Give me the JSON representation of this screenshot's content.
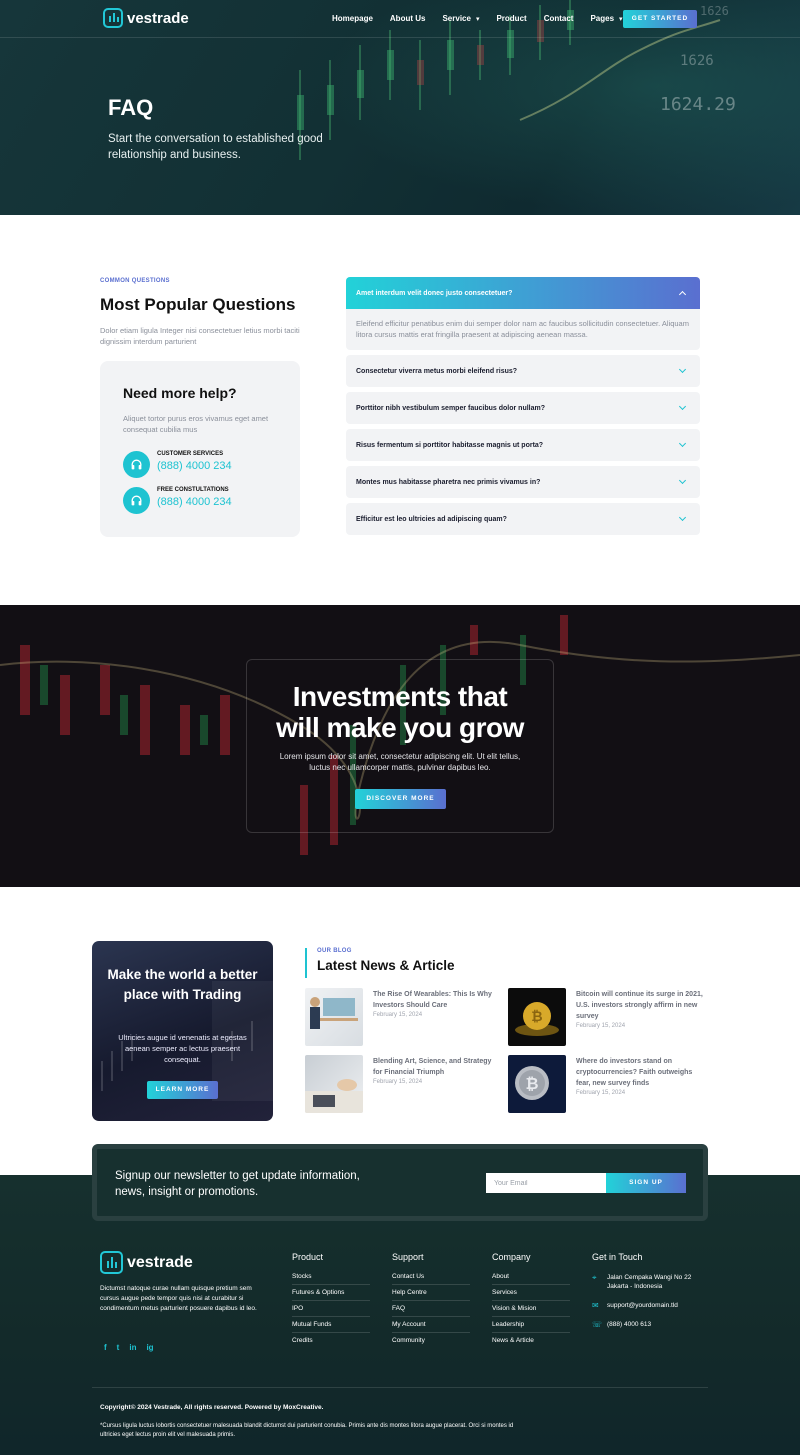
{
  "header": {
    "logo_text": "vestrade",
    "nav": [
      {
        "label": "Homepage",
        "dropdown": false
      },
      {
        "label": "About Us",
        "dropdown": false
      },
      {
        "label": "Service",
        "dropdown": true
      },
      {
        "label": "Product",
        "dropdown": false
      },
      {
        "label": "Contact",
        "dropdown": false
      },
      {
        "label": "Pages",
        "dropdown": true
      }
    ],
    "cta": "GET STARTED"
  },
  "hero": {
    "title": "FAQ",
    "subtitle": "Start the conversation to established good relationship and business.",
    "bg_numbers": [
      "1626",
      "1624.29",
      "1626"
    ]
  },
  "faq": {
    "eyebrow": "COMMON QUESTIONS",
    "title": "Most Popular Questions",
    "description": "Dolor etiam ligula Integer nisi consectetuer letius morbi taciti dignissim interdum parturient",
    "help": {
      "title": "Need more help?",
      "description": "Aliquet tortor purus eros vivamus eget amet consequat cubilia mus",
      "contacts": [
        {
          "label": "CUSTOMER SERVICES",
          "phone": "(888) 4000 234"
        },
        {
          "label": "FREE CONSTULTATIONS",
          "phone": "(888) 4000 234"
        }
      ]
    },
    "items": [
      {
        "question": "Amet interdum velit donec justo consectetuer?",
        "answer": "Eleifend efficitur penatibus enim dui semper dolor nam ac faucibus sollicitudin consectetuer. Aliquam litora cursus mattis erat fringilla praesent at adipiscing aenean massa.",
        "open": true
      },
      {
        "question": "Consectetur viverra metus morbi eleifend risus?",
        "open": false
      },
      {
        "question": "Porttitor nibh vestibulum semper faucibus dolor nullam?",
        "open": false
      },
      {
        "question": "Risus fermentum si porttitor habitasse magnis ut porta?",
        "open": false
      },
      {
        "question": "Montes mus habitasse pharetra nec primis vivamus in?",
        "open": false
      },
      {
        "question": "Efficitur est leo ultricies ad adipiscing quam?",
        "open": false
      }
    ]
  },
  "banner": {
    "title_line1": "Investments that",
    "title_line2": "will make you grow",
    "text": "Lorem ipsum dolor sit amet, consectetur adipiscing elit. Ut elit tellus, luctus nec ullamcorper mattis, pulvinar dapibus leo.",
    "cta": "DISCOVER MORE"
  },
  "blog": {
    "promo": {
      "title": "Make the world a better place with Trading",
      "text": "Ultricies augue id venenatis at egestas aenean semper ac lectus praesent consequat.",
      "cta": "LEARN MORE"
    },
    "eyebrow": "OUR BLOG",
    "title": "Latest News & Article",
    "posts": [
      {
        "title": "The Rise Of Wearables: This Is Why Investors Should Care",
        "date": "February 15, 2024"
      },
      {
        "title": "Bitcoin will continue its surge in 2021, U.S. investors strongly affirm in new survey",
        "date": "February 15, 2024"
      },
      {
        "title": "Blending Art, Science, and Strategy for Financial Triumph",
        "date": "February 15, 2024"
      },
      {
        "title": "Where do investors stand on cryptocurrencies? Faith outweighs fear, new survey finds",
        "date": "February 15, 2024"
      }
    ]
  },
  "newsletter": {
    "text": "Signup our newsletter to get update information, news, insight or promotions.",
    "placeholder": "Your Email",
    "cta": "SIGN UP"
  },
  "footer": {
    "logo_text": "vestrade",
    "about": "Dictumst natoque curae nullam quisque pretium sem cursus augue pede tempor quis nisi at curabitur si condimentum metus parturient posuere dapibus id leo.",
    "socials": [
      "f",
      "t",
      "in",
      "ig"
    ],
    "columns": [
      {
        "title": "Product",
        "links": [
          "Stocks",
          "Futures & Options",
          "IPO",
          "Mutual Funds",
          "Credits"
        ]
      },
      {
        "title": "Support",
        "links": [
          "Contact Us",
          "Help Centre",
          "FAQ",
          "My Account",
          "Community"
        ]
      },
      {
        "title": "Company",
        "links": [
          "About",
          "Services",
          "Vision & Mision",
          "Leadership",
          "News & Article"
        ]
      }
    ],
    "get_in_touch": {
      "title": "Get in Touch",
      "address": "Jalan Cempaka Wangi No 22 Jakarta - Indonesia",
      "email": "support@yourdomain.tld",
      "phone": "(888) 4000 613"
    },
    "copyright": "Copyright© 2024 Vestrade, All rights reserved. Powered by MoxCreative.",
    "note": "*Cursus ligula luctus lobortis consectetuer malesuada blandit dictumst dui parturient conubia. Primis ante dis montes litora augue placerat. Orci si montes id ultricies eget lectus proin elit vel malesuada primis."
  },
  "colors": {
    "accent": "#1ec3d1",
    "accent2": "#5a6fd0",
    "dark": "#132a2a"
  }
}
